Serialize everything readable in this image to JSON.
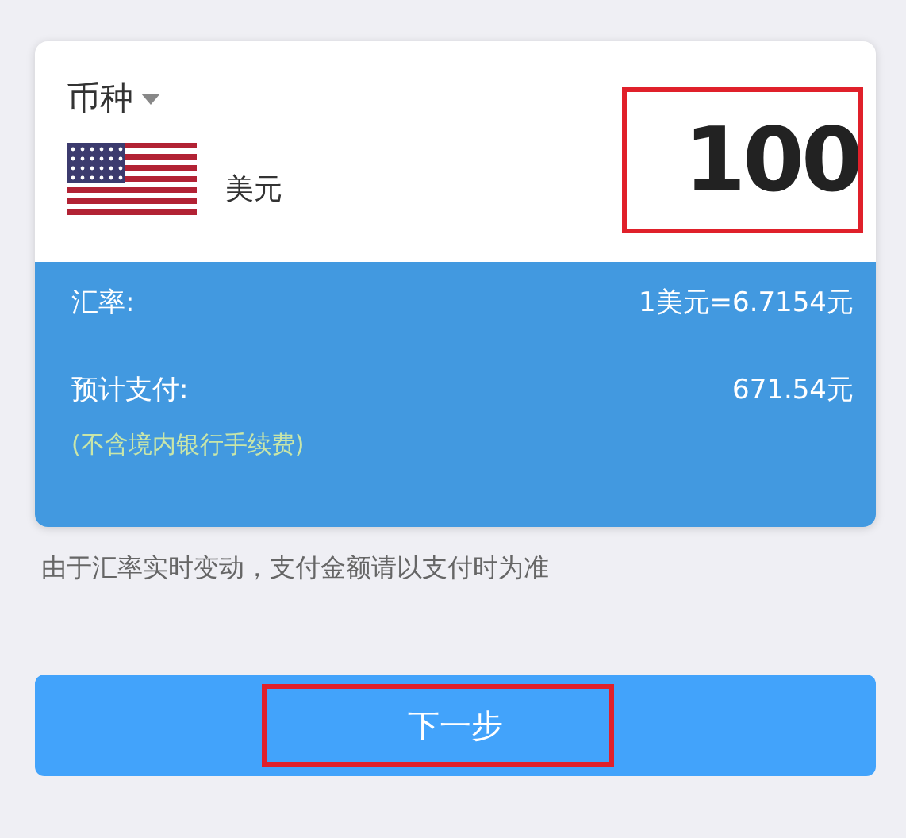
{
  "currency": {
    "label": "币种",
    "name": "美元"
  },
  "amount": {
    "value": "100",
    "highlighted": true
  },
  "rate": {
    "label": "汇率:",
    "value": "1美元=6.7154元"
  },
  "payment": {
    "label": "预计支付:",
    "value": "671.54元",
    "note": "(不含境内银行手续费)"
  },
  "notice": "由于汇率实时变动，支付金额请以支付时为准",
  "next_button": {
    "label": "下一步",
    "highlighted": true
  }
}
